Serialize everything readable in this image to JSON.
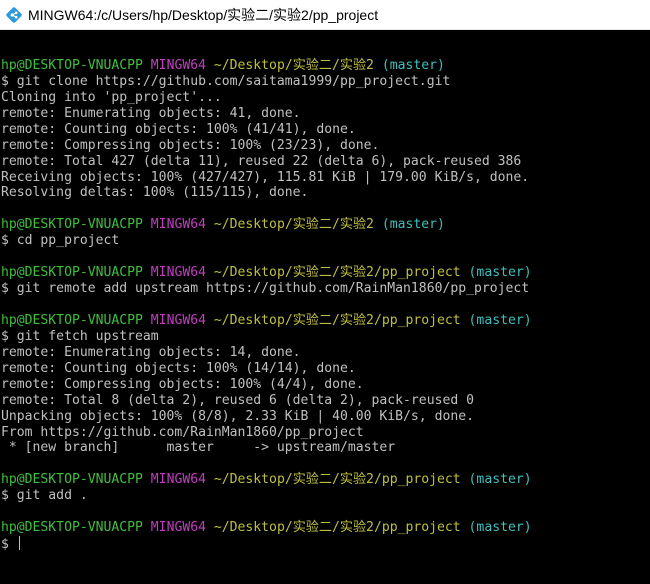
{
  "window": {
    "title": "MINGW64:/c/Users/hp/Desktop/实验二/实验2/pp_project",
    "icon": "git-bash-icon"
  },
  "colors": {
    "user": "#3fbf3f",
    "mingw": "#bf40bf",
    "path": "#bfbf3f",
    "branch": "#40bfbf",
    "text": "#c0c0c0",
    "background": "#000000"
  },
  "terminal": {
    "lines": [
      {
        "kind": "blank"
      },
      {
        "kind": "prompt",
        "user": "hp@DESKTOP-VNUACPP",
        "sys": "MINGW64",
        "path": "~/Desktop/实验二/实验2",
        "branch": "(master)"
      },
      {
        "kind": "text",
        "text": "$ git clone https://github.com/saitama1999/pp_project.git"
      },
      {
        "kind": "text",
        "text": "Cloning into 'pp_project'..."
      },
      {
        "kind": "text",
        "text": "remote: Enumerating objects: 41, done."
      },
      {
        "kind": "text",
        "text": "remote: Counting objects: 100% (41/41), done."
      },
      {
        "kind": "text",
        "text": "remote: Compressing objects: 100% (23/23), done."
      },
      {
        "kind": "text",
        "text": "remote: Total 427 (delta 11), reused 22 (delta 6), pack-reused 386"
      },
      {
        "kind": "text",
        "text": "Receiving objects: 100% (427/427), 115.81 KiB | 179.00 KiB/s, done."
      },
      {
        "kind": "text",
        "text": "Resolving deltas: 100% (115/115), done."
      },
      {
        "kind": "blank"
      },
      {
        "kind": "prompt",
        "user": "hp@DESKTOP-VNUACPP",
        "sys": "MINGW64",
        "path": "~/Desktop/实验二/实验2",
        "branch": "(master)"
      },
      {
        "kind": "text",
        "text": "$ cd pp_project"
      },
      {
        "kind": "blank"
      },
      {
        "kind": "prompt",
        "user": "hp@DESKTOP-VNUACPP",
        "sys": "MINGW64",
        "path": "~/Desktop/实验二/实验2/pp_project",
        "branch": "(master)"
      },
      {
        "kind": "text",
        "text": "$ git remote add upstream https://github.com/RainMan1860/pp_project"
      },
      {
        "kind": "blank"
      },
      {
        "kind": "prompt",
        "user": "hp@DESKTOP-VNUACPP",
        "sys": "MINGW64",
        "path": "~/Desktop/实验二/实验2/pp_project",
        "branch": "(master)"
      },
      {
        "kind": "text",
        "text": "$ git fetch upstream"
      },
      {
        "kind": "text",
        "text": "remote: Enumerating objects: 14, done."
      },
      {
        "kind": "text",
        "text": "remote: Counting objects: 100% (14/14), done."
      },
      {
        "kind": "text",
        "text": "remote: Compressing objects: 100% (4/4), done."
      },
      {
        "kind": "text",
        "text": "remote: Total 8 (delta 2), reused 6 (delta 2), pack-reused 0"
      },
      {
        "kind": "text",
        "text": "Unpacking objects: 100% (8/8), 2.33 KiB | 40.00 KiB/s, done."
      },
      {
        "kind": "text",
        "text": "From https://github.com/RainMan1860/pp_project"
      },
      {
        "kind": "text",
        "text": " * [new branch]      master     -> upstream/master"
      },
      {
        "kind": "blank"
      },
      {
        "kind": "prompt",
        "user": "hp@DESKTOP-VNUACPP",
        "sys": "MINGW64",
        "path": "~/Desktop/实验二/实验2/pp_project",
        "branch": "(master)"
      },
      {
        "kind": "text",
        "text": "$ git add ."
      },
      {
        "kind": "blank"
      },
      {
        "kind": "prompt",
        "user": "hp@DESKTOP-VNUACPP",
        "sys": "MINGW64",
        "path": "~/Desktop/实验二/实验2/pp_project",
        "branch": "(master)"
      },
      {
        "kind": "input",
        "text": "$ "
      }
    ]
  }
}
